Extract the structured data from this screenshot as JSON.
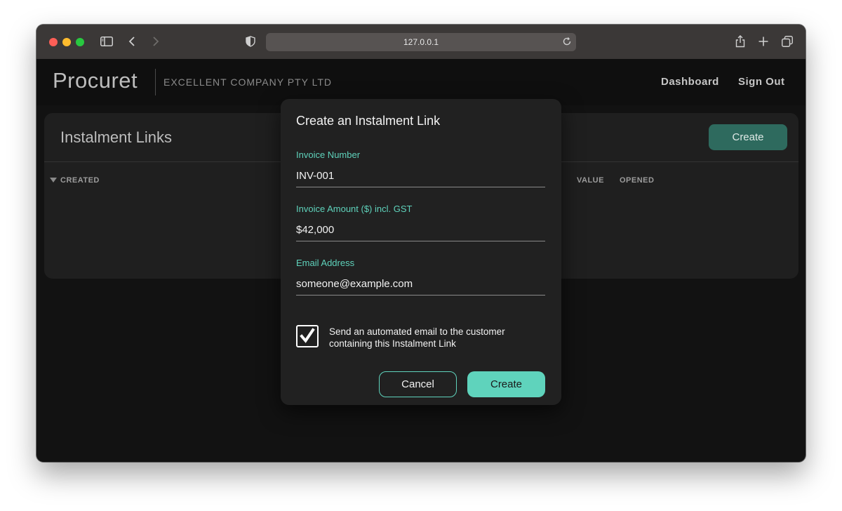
{
  "browser": {
    "url": "127.0.0.1"
  },
  "header": {
    "logo": "Procuret",
    "company": "EXCELLENT COMPANY PTY LTD",
    "nav": [
      "Dashboard",
      "Sign Out"
    ]
  },
  "card": {
    "title": "Instalment Links",
    "create_label": "Create",
    "columns": {
      "created": "CREATED",
      "value": "VALUE",
      "opened": "OPENED"
    }
  },
  "modal": {
    "title": "Create an Instalment Link",
    "fields": {
      "invoice_number": {
        "label": "Invoice Number",
        "value": "INV-001"
      },
      "invoice_amount": {
        "label": "Invoice Amount ($) incl. GST",
        "value": "$42,000"
      },
      "email": {
        "label": "Email Address",
        "value": "someone@example.com"
      }
    },
    "checkbox": {
      "checked": true,
      "label": "Send an automated email to the customer containing this Instalment Link"
    },
    "cancel_label": "Cancel",
    "create_label": "Create"
  },
  "colors": {
    "accent": "#5fd3bc",
    "card_button": "#2e6a5e",
    "background": "#121212"
  }
}
